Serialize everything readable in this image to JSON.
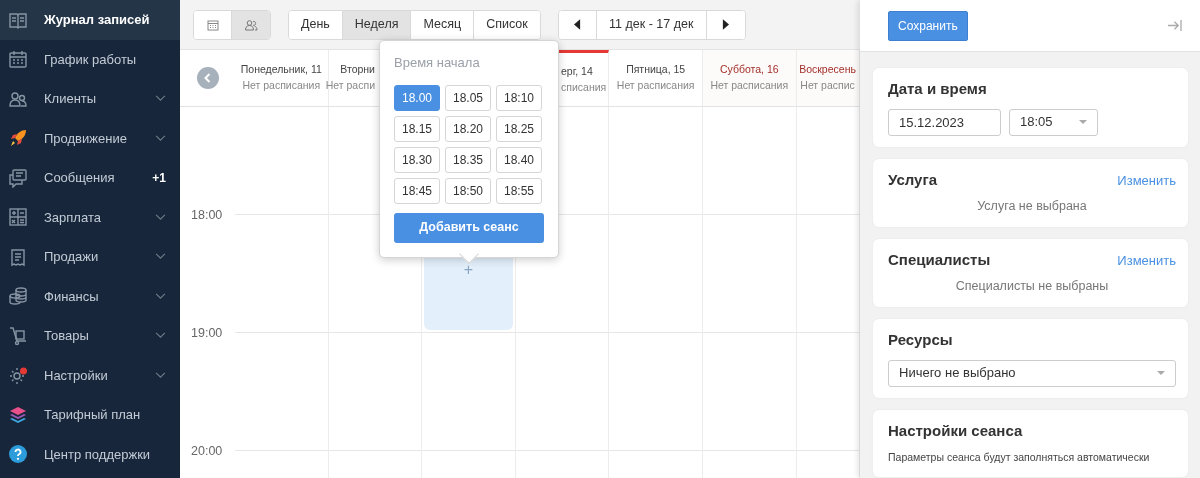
{
  "sidebar": {
    "items": [
      {
        "label": "Журнал записей",
        "active": true,
        "expandable": false
      },
      {
        "label": "График работы",
        "active": false,
        "expandable": false
      },
      {
        "label": "Клиенты",
        "active": false,
        "expandable": true
      },
      {
        "label": "Продвижение",
        "active": false,
        "expandable": true
      },
      {
        "label": "Сообщения",
        "active": false,
        "expandable": false,
        "badge": "+1"
      },
      {
        "label": "Зарплата",
        "active": false,
        "expandable": true
      },
      {
        "label": "Продажи",
        "active": false,
        "expandable": true
      },
      {
        "label": "Финансы",
        "active": false,
        "expandable": true
      },
      {
        "label": "Товары",
        "active": false,
        "expandable": true
      },
      {
        "label": "Настройки",
        "active": false,
        "expandable": true,
        "alert": true
      },
      {
        "label": "Тарифный план",
        "active": false,
        "expandable": false
      },
      {
        "label": "Центр поддержки",
        "active": false,
        "expandable": false
      }
    ]
  },
  "toolbar": {
    "modes": [
      {
        "selected": false
      },
      {
        "selected": true
      }
    ],
    "views": [
      {
        "label": "День",
        "selected": false
      },
      {
        "label": "Неделя",
        "selected": true
      },
      {
        "label": "Месяц",
        "selected": false
      },
      {
        "label": "Список",
        "selected": false
      }
    ],
    "range": "11 дек - 17 дек"
  },
  "calendar": {
    "days": [
      {
        "name": "Понедельник, 11",
        "subtitle": "Нет расписания",
        "weekend": false,
        "today": false
      },
      {
        "name": "Вторни",
        "subtitle": "Нет распи",
        "weekend": false,
        "today": false
      },
      {
        "slot": "+"
      },
      {
        "name": "ерг, 14",
        "subtitle": "списания",
        "weekend": false,
        "today": true
      },
      {
        "name": "Пятница, 15",
        "subtitle": "Нет расписания",
        "weekend": false,
        "today": false
      },
      {
        "name": "Суббота, 16",
        "subtitle": "Нет расписания",
        "weekend": true,
        "today": false
      },
      {
        "name": "Воскресень",
        "subtitle": "Нет распис",
        "weekend": true,
        "today": false
      }
    ],
    "hours": [
      "18:00",
      "19:00",
      "20:00"
    ]
  },
  "popover": {
    "title": "Время начала",
    "times": [
      {
        "label": "18.00",
        "selected": true
      },
      {
        "label": "18.05",
        "selected": false
      },
      {
        "label": "18:10",
        "selected": false
      },
      {
        "label": "18.15",
        "selected": false
      },
      {
        "label": "18.20",
        "selected": false
      },
      {
        "label": "18.25",
        "selected": false
      },
      {
        "label": "18.30",
        "selected": false
      },
      {
        "label": "18.35",
        "selected": false
      },
      {
        "label": "18.40",
        "selected": false
      },
      {
        "label": "18:45",
        "selected": false
      },
      {
        "label": "18:50",
        "selected": false
      },
      {
        "label": "18:55",
        "selected": false
      }
    ],
    "button": "Добавить сеанс"
  },
  "panel": {
    "save": "Сохранить",
    "sections": [
      {
        "kind": "datetime",
        "title": "Дата и время",
        "date": "15.12.2023",
        "time": "18:05"
      },
      {
        "kind": "summary",
        "title": "Услуга",
        "action": "Изменить",
        "empty": "Услуга не выбрана"
      },
      {
        "kind": "summary",
        "title": "Специалисты",
        "action": "Изменить",
        "empty": "Специалисты не выбраны"
      },
      {
        "kind": "select",
        "title": "Ресурсы",
        "value": "Ничего не выбрано"
      },
      {
        "kind": "note",
        "title": "Настройки сеанса",
        "text": "Параметры сеанса будут заполняться автоматически"
      }
    ]
  }
}
